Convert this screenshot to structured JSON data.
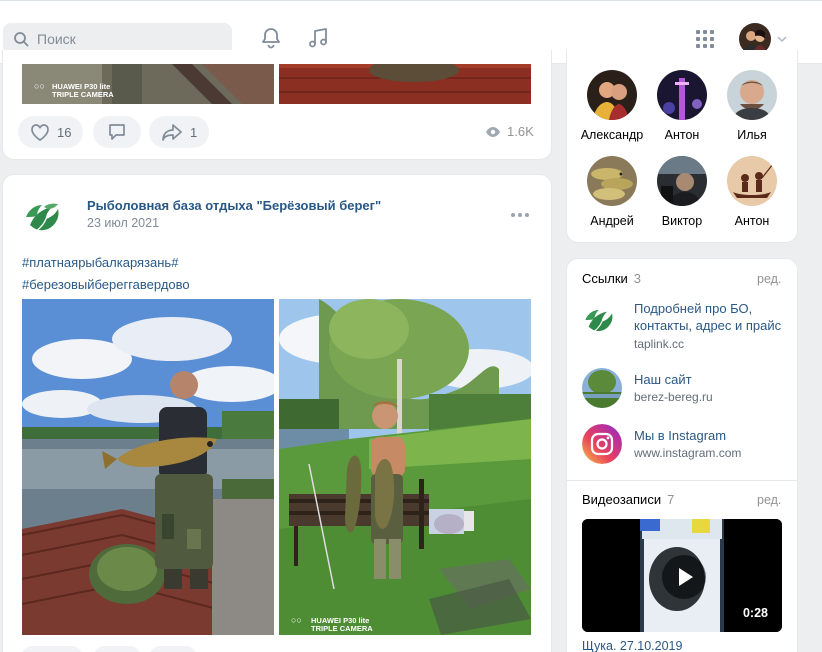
{
  "header": {
    "search_placeholder": "Поиск"
  },
  "prev_post": {
    "likes": "16",
    "reposts": "1",
    "views": "1.6K",
    "watermark_line1": "HUAWEI P30 lite",
    "watermark_line2": "TRIPLE CAMERA"
  },
  "post": {
    "author": "Рыболовная база отдыха \"Берёзовый берег\"",
    "date": "23 июл 2021",
    "hashtag1": "#платнаярыбалкарязань#",
    "hashtag2": "#березовыйбереггавердово",
    "watermark_line1": "HUAWEI P30 lite",
    "watermark_line2": "TRIPLE CAMERA"
  },
  "friends": [
    {
      "name": "Александр"
    },
    {
      "name": "Антон"
    },
    {
      "name": "Илья"
    },
    {
      "name": "Андрей"
    },
    {
      "name": "Виктор"
    },
    {
      "name": "Антон"
    }
  ],
  "links": {
    "title": "Ссылки",
    "count": "3",
    "edit": "ред.",
    "items": [
      {
        "title": "Подробней про БО, контакты, адрес и прайс",
        "url": "taplink.cc"
      },
      {
        "title": "Наш сайт",
        "url": "berez-bereg.ru"
      },
      {
        "title": "Мы в Instagram",
        "url": "www.instagram.com"
      }
    ]
  },
  "videos": {
    "title": "Видеозаписи",
    "count": "7",
    "edit": "ред.",
    "duration": "0:28",
    "caption": "Щука. 27.10.2019"
  },
  "colors": {
    "link": "#2a5885",
    "background": "#edeef0",
    "muted": "#939393"
  }
}
